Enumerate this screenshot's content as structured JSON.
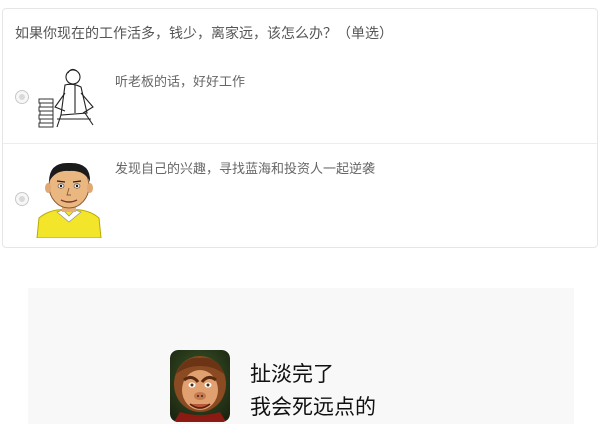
{
  "poll": {
    "question": "如果你现在的工作活多，钱少，离家远，该怎么办？（单选）",
    "options": [
      {
        "label": "听老板的话，好好工作",
        "icon": "sketch-worker-image",
        "selected": false
      },
      {
        "label": "发现自己的兴趣，寻找蓝海和投资人一起逆袭",
        "icon": "cartoon-man-yellow-sweater-image",
        "selected": false
      }
    ]
  },
  "meme": {
    "line1": "扯淡完了",
    "line2": "我会死远点的",
    "icon": "monkey-king-image"
  },
  "colors": {
    "border": "#e6e6e6",
    "question_text": "#555555",
    "option_text": "#666666",
    "meme_bg": "#f8f8f8",
    "meme_text": "#111111"
  }
}
